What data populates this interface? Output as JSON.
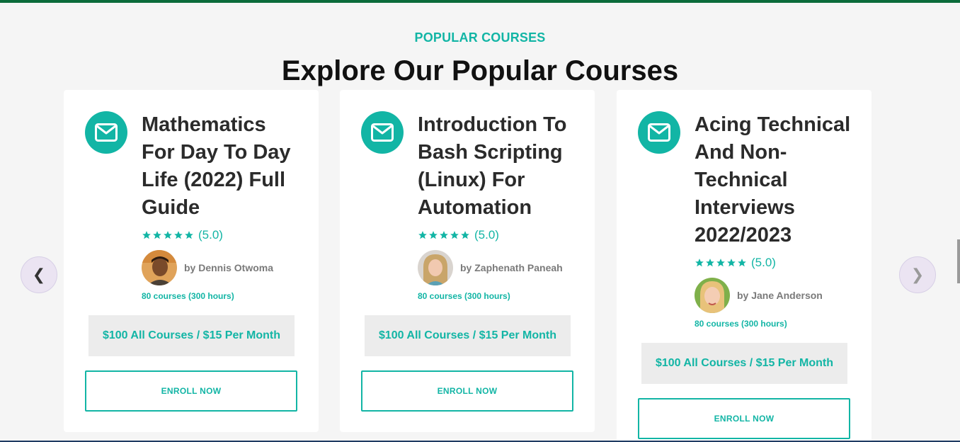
{
  "section": {
    "eyebrow": "POPULAR COURSES",
    "headline": "Explore Our Popular Courses"
  },
  "carousel": {
    "prev_icon": "chevron-left-icon",
    "prev_glyph": "❮",
    "next_icon": "chevron-right-icon",
    "next_glyph": "❯"
  },
  "courses": [
    {
      "icon": "envelope-icon",
      "title": "Mathematics For Day To Day Life (2022) Full Guide",
      "stars": 5,
      "rating_label": "(5.0)",
      "author": "by Dennis Otwoma",
      "meta": "80 courses (300 hours)",
      "price": "$100 All Courses / $15 Per Month",
      "cta": "ENROLL NOW"
    },
    {
      "icon": "envelope-icon",
      "title": "Introduction To Bash Scripting (Linux) For Automation",
      "stars": 5,
      "rating_label": "(5.0)",
      "author": "by Zaphenath Paneah",
      "meta": "80 courses (300 hours)",
      "price": "$100 All Courses / $15 Per Month",
      "cta": "ENROLL NOW"
    },
    {
      "icon": "envelope-icon",
      "title": "Acing Technical And Non-Technical Interviews 2022/2023",
      "stars": 5,
      "rating_label": "(5.0)",
      "author": "by Jane Anderson",
      "meta": "80 courses (300 hours)",
      "price": "$100 All Courses / $15 Per Month",
      "cta": "ENROLL NOW"
    }
  ],
  "colors": {
    "accent": "#12b5a5",
    "top_bar": "#0b6b3a",
    "heading": "#111111",
    "title": "#2b2b2b",
    "price_bg": "#ececec",
    "arrow_bg": "#ebe4f2"
  }
}
